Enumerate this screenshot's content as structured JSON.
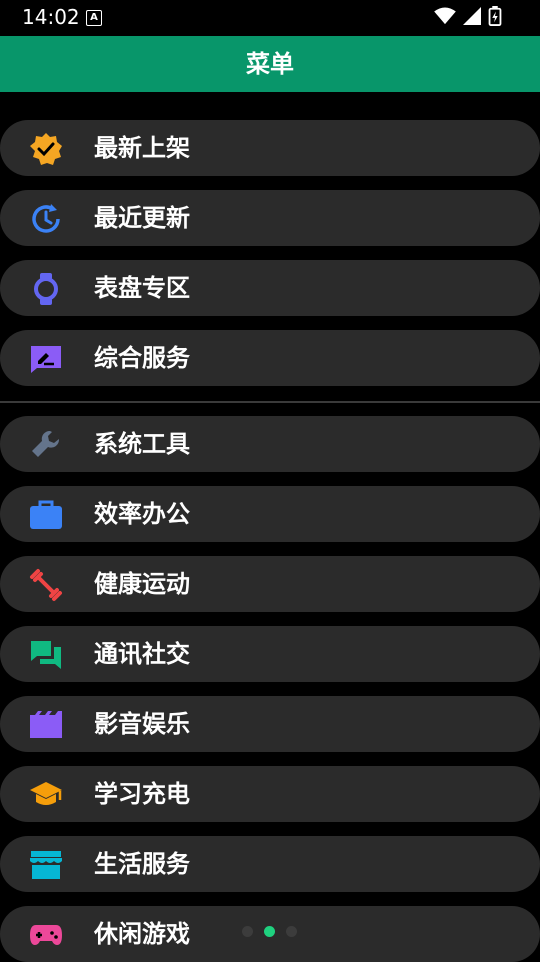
{
  "status": {
    "time": "14:02",
    "a_badge": "A"
  },
  "header": {
    "title": "菜单"
  },
  "menu": {
    "items": [
      {
        "label": "最新上架",
        "icon": "verified-badge-icon",
        "color": "#f5a623"
      },
      {
        "label": "最近更新",
        "icon": "history-refresh-icon",
        "color": "#3b82f6"
      },
      {
        "label": "表盘专区",
        "icon": "smartwatch-icon",
        "color": "#6366f1"
      },
      {
        "label": "综合服务",
        "icon": "edit-note-icon",
        "color": "#8b5cf6"
      },
      {
        "label": "系统工具",
        "icon": "wrench-icon",
        "color": "#64748b"
      },
      {
        "label": "效率办公",
        "icon": "briefcase-icon",
        "color": "#3b82f6"
      },
      {
        "label": "健康运动",
        "icon": "dumbbell-icon",
        "color": "#ef4444"
      },
      {
        "label": "通讯社交",
        "icon": "chat-bubbles-icon",
        "color": "#10b981"
      },
      {
        "label": "影音娱乐",
        "icon": "clapperboard-icon",
        "color": "#8b5cf6"
      },
      {
        "label": "学习充电",
        "icon": "graduation-cap-icon",
        "color": "#f59e0b"
      },
      {
        "label": "生活服务",
        "icon": "storefront-icon",
        "color": "#06b6d4"
      },
      {
        "label": "休闲游戏",
        "icon": "gamepad-icon",
        "color": "#ec4899"
      }
    ]
  },
  "pager": {
    "count": 3,
    "active_index": 1
  }
}
